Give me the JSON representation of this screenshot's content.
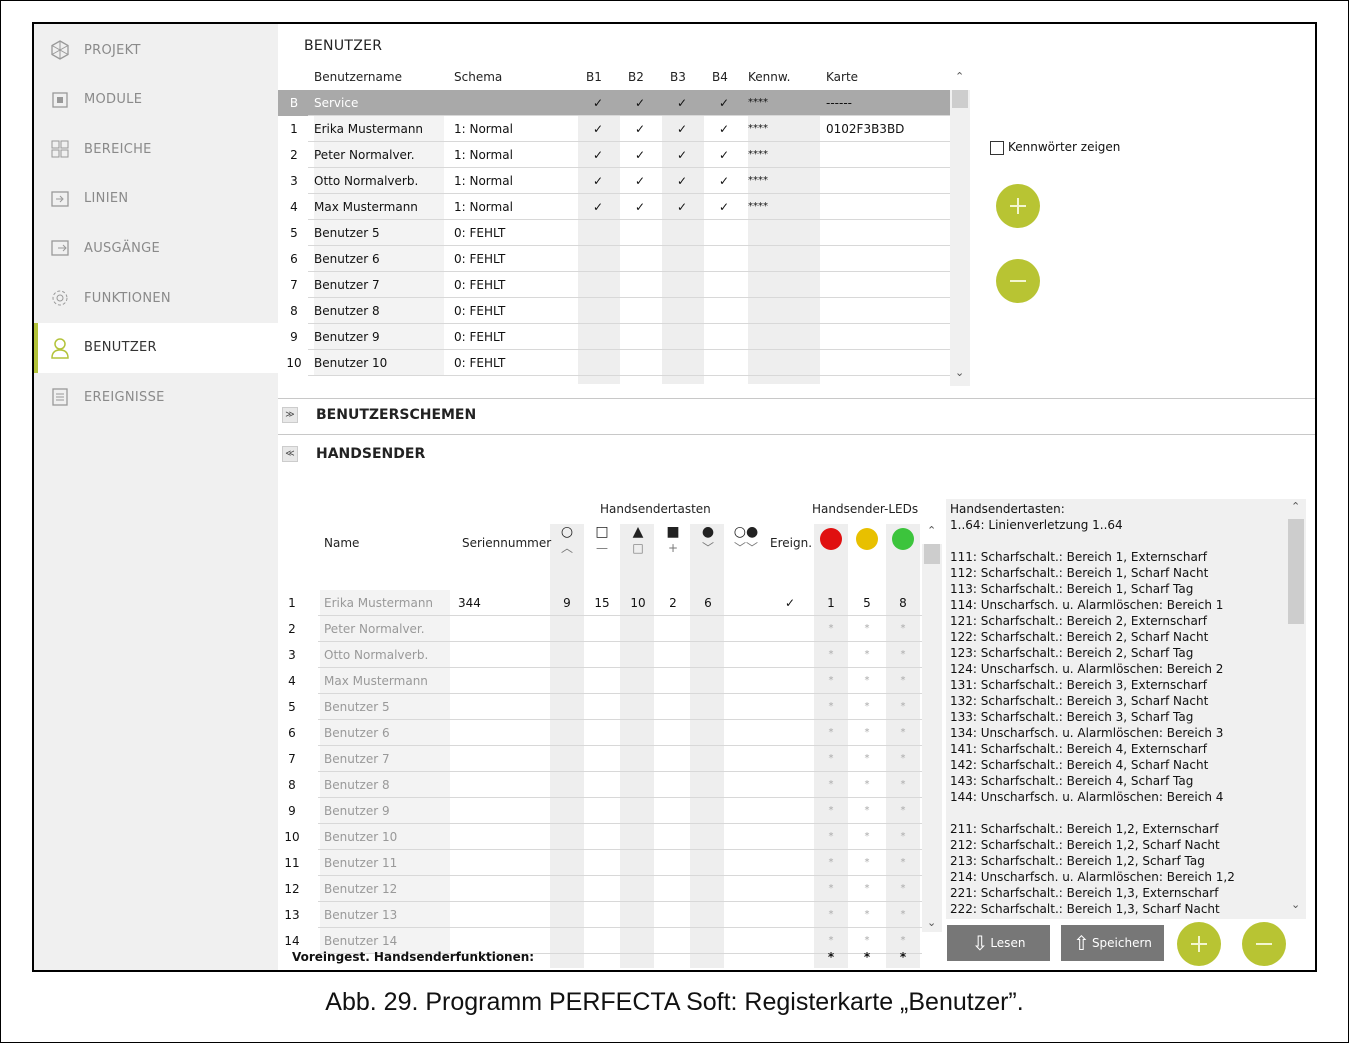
{
  "sidebar": {
    "items": [
      {
        "label": "PROJEKT",
        "icon": "project-icon"
      },
      {
        "label": "MODULE",
        "icon": "module-icon"
      },
      {
        "label": "BEREICHE",
        "icon": "partitions-icon"
      },
      {
        "label": "LINIEN",
        "icon": "zones-icon"
      },
      {
        "label": "AUSGÄNGE",
        "icon": "outputs-icon"
      },
      {
        "label": "FUNKTIONEN",
        "icon": "functions-gear-icon"
      },
      {
        "label": "BENUTZER",
        "icon": "user-icon"
      },
      {
        "label": "EREIGNISSE",
        "icon": "events-list-icon"
      }
    ],
    "active_index": 6,
    "accent_color": "#b3c33a"
  },
  "users": {
    "title": "BENUTZER",
    "headers": {
      "name": "Benutzername",
      "schema": "Schema",
      "b1": "B1",
      "b2": "B2",
      "b3": "B3",
      "b4": "B4",
      "pwd": "Kennw.",
      "card": "Karte"
    },
    "rows": [
      {
        "num": "B",
        "name": "Service",
        "schema": "",
        "b1": "✓",
        "b2": "✓",
        "b3": "✓",
        "b4": "✓",
        "pwd": "****",
        "card": "------"
      },
      {
        "num": "1",
        "name": "Erika Mustermann",
        "schema": "1: Normal",
        "b1": "✓",
        "b2": "✓",
        "b3": "✓",
        "b4": "✓",
        "pwd": "****",
        "card": "0102F3B3BD"
      },
      {
        "num": "2",
        "name": "Peter Normalver.",
        "schema": "1: Normal",
        "b1": "✓",
        "b2": "✓",
        "b3": "✓",
        "b4": "✓",
        "pwd": "****",
        "card": ""
      },
      {
        "num": "3",
        "name": "Otto Normalverb.",
        "schema": "1: Normal",
        "b1": "✓",
        "b2": "✓",
        "b3": "✓",
        "b4": "✓",
        "pwd": "****",
        "card": ""
      },
      {
        "num": "4",
        "name": "Max Mustermann",
        "schema": "1: Normal",
        "b1": "✓",
        "b2": "✓",
        "b3": "✓",
        "b4": "✓",
        "pwd": "****",
        "card": ""
      },
      {
        "num": "5",
        "name": "Benutzer  5",
        "schema": "0: FEHLT",
        "b1": "",
        "b2": "",
        "b3": "",
        "b4": "",
        "pwd": "",
        "card": ""
      },
      {
        "num": "6",
        "name": "Benutzer  6",
        "schema": "0: FEHLT",
        "b1": "",
        "b2": "",
        "b3": "",
        "b4": "",
        "pwd": "",
        "card": ""
      },
      {
        "num": "7",
        "name": "Benutzer  7",
        "schema": "0: FEHLT",
        "b1": "",
        "b2": "",
        "b3": "",
        "b4": "",
        "pwd": "",
        "card": ""
      },
      {
        "num": "8",
        "name": "Benutzer  8",
        "schema": "0: FEHLT",
        "b1": "",
        "b2": "",
        "b3": "",
        "b4": "",
        "pwd": "",
        "card": ""
      },
      {
        "num": "9",
        "name": "Benutzer  9",
        "schema": "0: FEHLT",
        "b1": "",
        "b2": "",
        "b3": "",
        "b4": "",
        "pwd": "",
        "card": ""
      },
      {
        "num": "10",
        "name": "Benutzer  10",
        "schema": "0: FEHLT",
        "b1": "",
        "b2": "",
        "b3": "",
        "b4": "",
        "pwd": "",
        "card": ""
      }
    ],
    "show_passwords_label": "Kennwörter zeigen",
    "show_passwords_checked": false
  },
  "schemes": {
    "title": "BENUTZERSCHEMEN",
    "toggle": "≫"
  },
  "keyfobs": {
    "title": "HANDSENDER",
    "toggle": "≪",
    "group_buttons": "Handsendertasten",
    "group_leds": "Handsender-LEDs",
    "headers": {
      "name": "Name",
      "serial": "Seriennummer",
      "event": "Ereign."
    },
    "button_icons": [
      "circle-up-icon",
      "square-minus-icon",
      "triangle-square-icon",
      "square-plus-icon",
      "circle-down-icon",
      "two-circles-icon"
    ],
    "led_colors": [
      "#e01010",
      "#e8c000",
      "#3cc43c"
    ],
    "rows": [
      {
        "num": "1",
        "name": "Erika Mustermann",
        "serial": "344",
        "k1": "9",
        "k2": "15",
        "k3": "10",
        "k4": "2",
        "k5": "6",
        "k6": "",
        "ev": "✓",
        "l1": "1",
        "l2": "5",
        "l3": "8"
      },
      {
        "num": "2",
        "name": "Peter Normalver.",
        "serial": "",
        "k1": "",
        "k2": "",
        "k3": "",
        "k4": "",
        "k5": "",
        "k6": "",
        "ev": "",
        "l1": "*",
        "l2": "*",
        "l3": "*"
      },
      {
        "num": "3",
        "name": "Otto Normalverb.",
        "serial": "",
        "k1": "",
        "k2": "",
        "k3": "",
        "k4": "",
        "k5": "",
        "k6": "",
        "ev": "",
        "l1": "*",
        "l2": "*",
        "l3": "*"
      },
      {
        "num": "4",
        "name": "Max Mustermann",
        "serial": "",
        "k1": "",
        "k2": "",
        "k3": "",
        "k4": "",
        "k5": "",
        "k6": "",
        "ev": "",
        "l1": "*",
        "l2": "*",
        "l3": "*"
      },
      {
        "num": "5",
        "name": "Benutzer  5",
        "serial": "",
        "k1": "",
        "k2": "",
        "k3": "",
        "k4": "",
        "k5": "",
        "k6": "",
        "ev": "",
        "l1": "*",
        "l2": "*",
        "l3": "*"
      },
      {
        "num": "6",
        "name": "Benutzer  6",
        "serial": "",
        "k1": "",
        "k2": "",
        "k3": "",
        "k4": "",
        "k5": "",
        "k6": "",
        "ev": "",
        "l1": "*",
        "l2": "*",
        "l3": "*"
      },
      {
        "num": "7",
        "name": "Benutzer  7",
        "serial": "",
        "k1": "",
        "k2": "",
        "k3": "",
        "k4": "",
        "k5": "",
        "k6": "",
        "ev": "",
        "l1": "*",
        "l2": "*",
        "l3": "*"
      },
      {
        "num": "8",
        "name": "Benutzer  8",
        "serial": "",
        "k1": "",
        "k2": "",
        "k3": "",
        "k4": "",
        "k5": "",
        "k6": "",
        "ev": "",
        "l1": "*",
        "l2": "*",
        "l3": "*"
      },
      {
        "num": "9",
        "name": "Benutzer  9",
        "serial": "",
        "k1": "",
        "k2": "",
        "k3": "",
        "k4": "",
        "k5": "",
        "k6": "",
        "ev": "",
        "l1": "*",
        "l2": "*",
        "l3": "*"
      },
      {
        "num": "10",
        "name": "Benutzer  10",
        "serial": "",
        "k1": "",
        "k2": "",
        "k3": "",
        "k4": "",
        "k5": "",
        "k6": "",
        "ev": "",
        "l1": "*",
        "l2": "*",
        "l3": "*"
      },
      {
        "num": "11",
        "name": "Benutzer  11",
        "serial": "",
        "k1": "",
        "k2": "",
        "k3": "",
        "k4": "",
        "k5": "",
        "k6": "",
        "ev": "",
        "l1": "*",
        "l2": "*",
        "l3": "*"
      },
      {
        "num": "12",
        "name": "Benutzer  12",
        "serial": "",
        "k1": "",
        "k2": "",
        "k3": "",
        "k4": "",
        "k5": "",
        "k6": "",
        "ev": "",
        "l1": "*",
        "l2": "*",
        "l3": "*"
      },
      {
        "num": "13",
        "name": "Benutzer  13",
        "serial": "",
        "k1": "",
        "k2": "",
        "k3": "",
        "k4": "",
        "k5": "",
        "k6": "",
        "ev": "",
        "l1": "*",
        "l2": "*",
        "l3": "*"
      },
      {
        "num": "14",
        "name": "Benutzer  14",
        "serial": "",
        "k1": "",
        "k2": "",
        "k3": "",
        "k4": "",
        "k5": "",
        "k6": "",
        "ev": "",
        "l1": "*",
        "l2": "*",
        "l3": "*"
      }
    ],
    "defaults_label": "Voreingest. Handsenderfunktionen:",
    "defaults_leds": [
      "*",
      "*",
      "*"
    ]
  },
  "help": {
    "lines": [
      "Handsendertasten:",
      "  1..64: Linienverletzung  1..64",
      "",
      "111: Scharfschalt.: Bereich 1, Externscharf",
      "112: Scharfschalt.: Bereich 1, Scharf Nacht",
      "113: Scharfschalt.: Bereich 1, Scharf Tag",
      "114: Unscharfsch. u. Alarmlöschen: Bereich 1",
      "121: Scharfschalt.: Bereich 2, Externscharf",
      "122: Scharfschalt.: Bereich 2, Scharf Nacht",
      "123: Scharfschalt.: Bereich 2, Scharf Tag",
      "124: Unscharfsch. u. Alarmlöschen: Bereich 2",
      "131: Scharfschalt.: Bereich 3, Externscharf",
      "132: Scharfschalt.: Bereich 3, Scharf Nacht",
      "133: Scharfschalt.: Bereich 3, Scharf Tag",
      "134: Unscharfsch. u. Alarmlöschen: Bereich 3",
      "141: Scharfschalt.: Bereich 4, Externscharf",
      "142: Scharfschalt.: Bereich 4, Scharf Nacht",
      "143: Scharfschalt.: Bereich 4, Scharf Tag",
      "144: Unscharfsch. u. Alarmlöschen: Bereich 4",
      "",
      "211: Scharfschalt.: Bereich 1,2, Externscharf",
      "212: Scharfschalt.: Bereich 1,2, Scharf Nacht",
      "213: Scharfschalt.: Bereich 1,2, Scharf Tag",
      "214: Unscharfsch. u. Alarmlöschen: Bereich 1,2",
      "221: Scharfschalt.: Bereich 1,3, Externscharf",
      "222: Scharfschalt.: Bereich 1,3, Scharf Nacht"
    ]
  },
  "actions": {
    "read": "Lesen",
    "save": "Speichern"
  },
  "caption": "Abb. 29. Programm PERFECTA Soft: Registerkarte „Benutzer”."
}
